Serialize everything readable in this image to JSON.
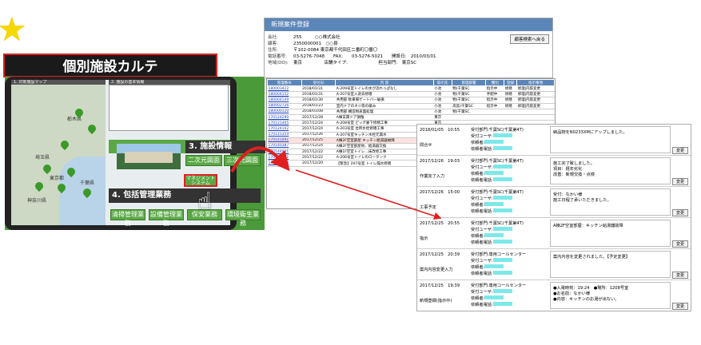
{
  "star": "★",
  "karte_title": "個別施設カルテ",
  "tablet": {
    "section1": "1. 対象施設マップ",
    "section2": "2. 施設の基本情報",
    "section3": "3. 施設情報",
    "section4": "4. 包括管理業務",
    "map_labels": [
      "栃木県",
      "埼玉県",
      "東京都",
      "千葉県",
      "神奈川県"
    ],
    "buttons_row1": [
      "二次元図面",
      "三次元図面"
    ],
    "highlight_button": "マネジメントシステム",
    "buttons_row4": [
      "清掃管理業務",
      "設備管理業務",
      "保安業務",
      "環境衛生業務"
    ]
  },
  "panel1": {
    "title": "新規案件登録",
    "rows": [
      {
        "label": "会社:",
        "value": "255　　　○○株式会社"
      },
      {
        "label": "顧客:",
        "value": "2350000001　○○县"
      },
      {
        "label": "住所:",
        "value": "〒102-0084 東京都千代田区二番町〇番〇"
      },
      {
        "label": "電話番号:",
        "value": "03-5276-7048　　FAX:　　03-5276-5021　　開設日:　2010/03/01"
      },
      {
        "label": "地域(DO):",
        "value": "東京　　　　　店舗タイプ:　　　　　　　担当部門:　東京SC"
      }
    ],
    "button": "顧客検索へ戻る"
  },
  "panel2": {
    "headers": [
      "管理番号",
      "受付日",
      "内 容",
      "取引先",
      "管理部署",
      "種別",
      "登録",
      "指示事項"
    ],
    "rows": [
      [
        "180003422",
        "2018/01/31",
        "A-209号室トイレの水が流れっぱなし",
        "小池",
        "物)千葉SC",
        "指示中",
        "修繕",
        "修理|内容変更"
      ],
      [
        "180004152",
        "2018/01/31",
        "A-207号室入退去修繕",
        "小池",
        "物)千葉SC",
        "手配中",
        "修繕",
        "修理|内容変更"
      ],
      [
        "180004149",
        "2018/01/30",
        "共用部 駐車場ゲートバー破損",
        "小池",
        "物)千葉SC",
        "指示中",
        "修繕",
        "修理|内容変更"
      ],
      [
        "180002726",
        "2018/01/23",
        "室内ドアのネジ等の緩み",
        "小池",
        "高島)千葉SC",
        "指示中",
        "修繕",
        "修理|内容変更"
      ],
      [
        "180000120",
        "2018/01/08",
        "共用部 構造物表面処理",
        "小池",
        "物)千葉SC",
        "",
        "",
        ""
      ],
      [
        "170124290",
        "2017/12/28",
        "A棟玄関ドア損傷",
        "東京",
        "",
        "",
        "",
        ""
      ],
      [
        "170121405",
        "2017/12/24",
        "A-208号室 ピッグ廊下修繕工事",
        "東京",
        "",
        "",
        "",
        ""
      ],
      [
        "170124102",
        "2017/12/24",
        "A-203号室 台所水栓修繕工事",
        "東京",
        "",
        "",
        "",
        ""
      ],
      [
        "170115354",
        "2017/12/26",
        "A-207号室キッチン水栓元漏水",
        "中央",
        "",
        "",
        "",
        ""
      ],
      [
        "170141091",
        "2017/12/25",
        "A棟2F空室部屋 キッチン給湯器故障",
        "世田",
        "",
        "",
        "",
        ""
      ],
      [
        "170140387",
        "2017/12/24",
        "A棟2F空室部屋他、給湯器交換",
        "東京",
        "",
        "",
        "",
        ""
      ],
      [
        "170144901",
        "2017/12/22",
        "A棟1F空室トイレ…床改修工事",
        "東京",
        "",
        "",
        "",
        ""
      ],
      [
        "170139881",
        "2017/12/22",
        "A-206号室トイレのロータンク",
        "東京",
        "",
        "",
        "",
        ""
      ],
      [
        "170139390",
        "2017/12/20",
        "【緊急】207号室 トイレ漏水修繕",
        "東京",
        "",
        "",
        "",
        ""
      ]
    ],
    "selected_index": 9
  },
  "panel3": {
    "change_button": "変更",
    "rows": [
      {
        "date": "2018/01/05　10:55",
        "status": "問合せ",
        "dept": "千葉SC(千葉第4T)",
        "text": "納品物をN0233XMにアップしました。"
      },
      {
        "date": "2017/12/26　19:03",
        "status": "作業完了入力",
        "dept": "千葉SC(千葉第4T)",
        "text": "施工完了致しました。\n項目：経年劣化\n改善：新規交換・点検"
      },
      {
        "date": "2017/12/26　15:00",
        "status": "工事予定",
        "dept": "千葉SC(千葉第4T)",
        "text": "受付：なかい様\n施工日程了承いただきました。"
      },
      {
        "date": "2017/12/25　20:55",
        "status": "指示",
        "dept": "千葉SC(千葉第4T)",
        "text": "A棟2F空室部屋：キッチン給湯器故障"
      },
      {
        "date": "2017/12/25　20:39",
        "status": "案内内容変更入力",
        "dept": "専用コールセンター",
        "text": "案内内容を変更されました。【予定変更】"
      },
      {
        "date": "2017/12/25　19:39",
        "status": "新規登録(指示中)",
        "dept": "専用コールセンター",
        "text": "●入電時刻：19:24　●場所：1208号室\n●お名前：なかい様\n●内容：キッチンのお湯が出ない。"
      }
    ],
    "field_labels": [
      "受付部門:",
      "受付ユーザ:",
      "依頼者:",
      "依頼者電話:"
    ]
  }
}
